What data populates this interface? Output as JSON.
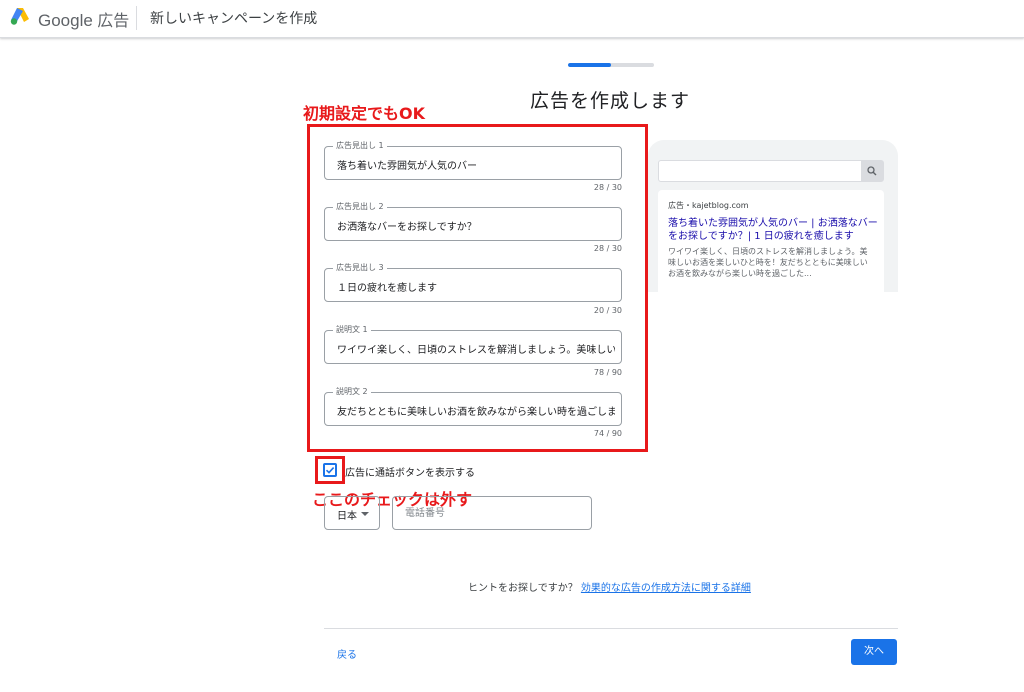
{
  "header": {
    "brand_google": "Google",
    "brand_product": "広告",
    "title": "新しいキャンペーンを作成"
  },
  "progress": {
    "value": 0.5
  },
  "page_title": "広告を作成します",
  "annotations": {
    "top": "初期設定でもOK",
    "bottom": "ここのチェックは外す"
  },
  "fields": [
    {
      "label": "広告見出し 1",
      "value": "落ち着いた雰囲気が人気のバー",
      "count": "28 / 30"
    },
    {
      "label": "広告見出し 2",
      "value": "お洒落なバーをお探しですか？",
      "count": "28 / 30"
    },
    {
      "label": "広告見出し 3",
      "value": "１日の疲れを癒します",
      "count": "20 / 30"
    },
    {
      "label": "説明文 1",
      "value": "ワイワイ楽しく、日頃のストレスを解消しましょう。美味しい",
      "count": "78 / 90"
    },
    {
      "label": "説明文 2",
      "value": "友だちとともに美味しいお酒を飲みながら楽しい時を過ごしま",
      "count": "74 / 90"
    }
  ],
  "preview": {
    "url": "広告・kajetblog.com",
    "headline": "落ち着いた雰囲気が人気のバー | お洒落なバーをお探しですか？| 1 日の疲れを癒します",
    "description": "ワイワイ楽しく、日頃のストレスを解消しましょう。美味しいお酒を楽しいひと時を！友だちとともに美味しいお酒を飲みながら楽しい時を過ごした..."
  },
  "call_button": {
    "label": "広告に通話ボタンを表示する",
    "checked": true
  },
  "phone": {
    "country": "日本",
    "placeholder": "電話番号"
  },
  "hint": {
    "text": "ヒントをお探しですか？",
    "link": "効果的な広告の作成方法に関する詳細"
  },
  "footer": {
    "back": "戻る",
    "next": "次へ"
  },
  "colors": {
    "accent": "#1a73e8",
    "annotation_red": "#e8191b"
  }
}
